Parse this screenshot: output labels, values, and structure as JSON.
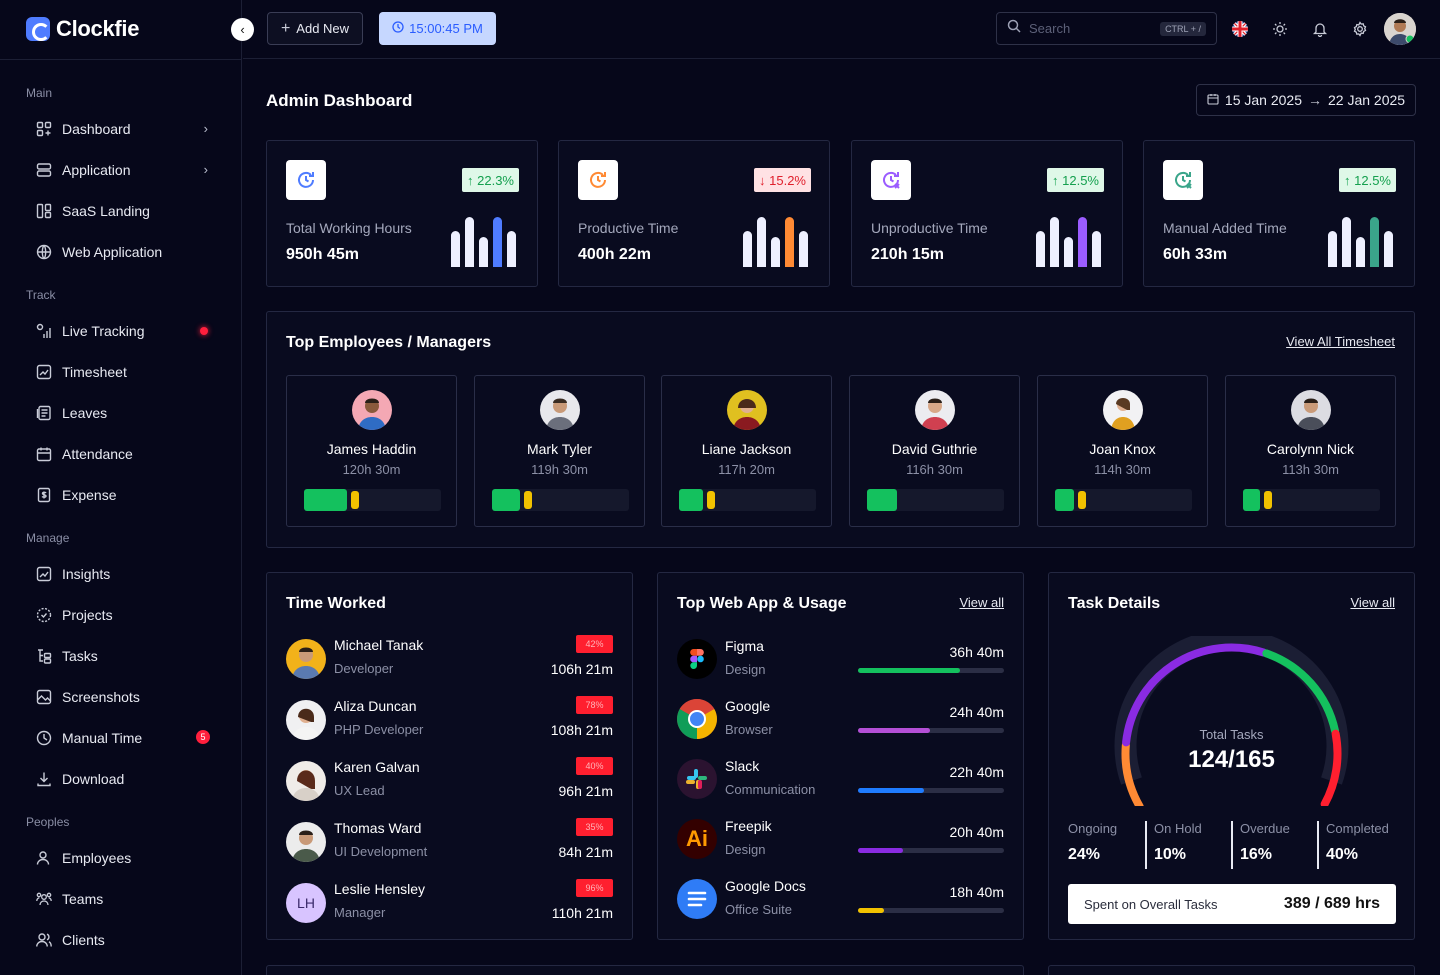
{
  "app": {
    "name": "Clockfie"
  },
  "sidebar": {
    "sections": {
      "main": "Main",
      "track": "Track",
      "manage": "Manage",
      "peoples": "Peoples"
    },
    "items": [
      {
        "label": "Dashboard",
        "icon": "grid-icon"
      },
      {
        "label": "Application",
        "icon": "layers-icon"
      },
      {
        "label": "SaaS Landing",
        "icon": "layout-icon"
      },
      {
        "label": "Web Application",
        "icon": "globe-icon"
      },
      {
        "label": "Live Tracking",
        "icon": "signal-icon"
      },
      {
        "label": "Timesheet",
        "icon": "chart-icon"
      },
      {
        "label": "Leaves",
        "icon": "document-icon"
      },
      {
        "label": "Attendance",
        "icon": "calendar-icon"
      },
      {
        "label": "Expense",
        "icon": "receipt-icon"
      },
      {
        "label": "Insights",
        "icon": "insights-icon"
      },
      {
        "label": "Projects",
        "icon": "projects-icon"
      },
      {
        "label": "Tasks",
        "icon": "tasks-icon"
      },
      {
        "label": "Screenshots",
        "icon": "image-icon"
      },
      {
        "label": "Manual Time",
        "icon": "clock-icon",
        "badge": "5"
      },
      {
        "label": "Download",
        "icon": "download-icon"
      },
      {
        "label": "Employees",
        "icon": "user-icon"
      },
      {
        "label": "Teams",
        "icon": "team-icon"
      },
      {
        "label": "Clients",
        "icon": "clients-icon"
      }
    ]
  },
  "topbar": {
    "add_label": "Add New",
    "clock": "15:00:45 PM",
    "search_placeholder": "Search",
    "search_shortcut": "CTRL + /"
  },
  "page": {
    "title": "Admin Dashboard",
    "date_from": "15 Jan 2025",
    "date_to": "22 Jan 2025"
  },
  "stats": [
    {
      "label": "Total Working Hours",
      "value": "950h 45m",
      "change": "22.3%",
      "trend": "up",
      "color": "#4f7cff"
    },
    {
      "label": "Productive Time",
      "value": "400h 22m",
      "change": "15.2%",
      "trend": "down",
      "color": "#ff8a34"
    },
    {
      "label": "Unproductive Time",
      "value": "210h 15m",
      "change": "12.5%",
      "trend": "up",
      "color": "#9b5cff"
    },
    {
      "label": "Manual Added Time",
      "value": "60h 33m",
      "change": "12.5%",
      "trend": "up",
      "color": "#3aa58a"
    }
  ],
  "top_employees": {
    "title": "Top Employees / Managers",
    "view_all": "View All Timesheet",
    "people": [
      {
        "name": "James Haddin",
        "hours": "120h 30m",
        "progress": 0.37
      },
      {
        "name": "Mark Tyler",
        "hours": "119h 30m",
        "progress": 0.26
      },
      {
        "name": "Liane Jackson",
        "hours": "117h 20m",
        "progress": 0.23
      },
      {
        "name": "David Guthrie",
        "hours": "116h 30m",
        "progress": 0.22
      },
      {
        "name": "Joan Knox",
        "hours": "114h 30m",
        "progress": 0.2
      },
      {
        "name": "Carolynn Nick",
        "hours": "113h 30m",
        "progress": 0.18
      }
    ]
  },
  "time_worked": {
    "title": "Time Worked",
    "rows": [
      {
        "name": "Michael Tanak",
        "role": "Developer",
        "percent": "42%",
        "time": "106h 21m"
      },
      {
        "name": "Aliza Duncan",
        "role": "PHP Developer",
        "percent": "78%",
        "time": "108h 21m"
      },
      {
        "name": "Karen Galvan",
        "role": "UX Lead",
        "percent": "40%",
        "time": "96h 21m"
      },
      {
        "name": "Thomas Ward",
        "role": "UI Development",
        "percent": "35%",
        "time": "84h 21m"
      },
      {
        "name": "Leslie Hensley",
        "role": "Manager",
        "percent": "96%",
        "time": "110h 21m",
        "initials": "LH"
      }
    ]
  },
  "web_apps": {
    "title": "Top Web App & Usage",
    "view_all": "View all",
    "rows": [
      {
        "name": "Figma",
        "category": "Design",
        "time": "36h 40m",
        "usage": 0.7,
        "color": "#14c15e",
        "icon": "figma-icon"
      },
      {
        "name": "Google",
        "category": "Browser",
        "time": "24h 40m",
        "usage": 0.49,
        "color": "#b44fd6",
        "icon": "chrome-icon"
      },
      {
        "name": "Slack",
        "category": "Communication",
        "time": "22h 40m",
        "usage": 0.45,
        "color": "#1f7cff",
        "icon": "slack-icon"
      },
      {
        "name": "Freepik",
        "category": "Design",
        "time": "20h 40m",
        "usage": 0.31,
        "color": "#8a2be2",
        "icon": "illustrator-icon",
        "logo_text": "Ai"
      },
      {
        "name": "Google Docs",
        "category": "Office Suite",
        "time": "18h 40m",
        "usage": 0.18,
        "color": "#f2c200",
        "icon": "docs-icon"
      }
    ]
  },
  "tasks": {
    "title": "Task Details",
    "view_all": "View all",
    "total_label": "Total Tasks",
    "total_value": "124/165",
    "gauge_fraction": 0.75,
    "breakdown": [
      {
        "label": "Ongoing",
        "value": "24%",
        "color": "#ff8a34"
      },
      {
        "label": "On Hold",
        "value": "10%",
        "color": "#8a2be2"
      },
      {
        "label": "Overdue",
        "value": "16%",
        "color": "#14c15e"
      },
      {
        "label": "Completed",
        "value": "40%",
        "color": "#ff1f2f"
      }
    ],
    "spent_label": "Spent on Overall Tasks",
    "spent_value": "389 / 689 hrs"
  }
}
